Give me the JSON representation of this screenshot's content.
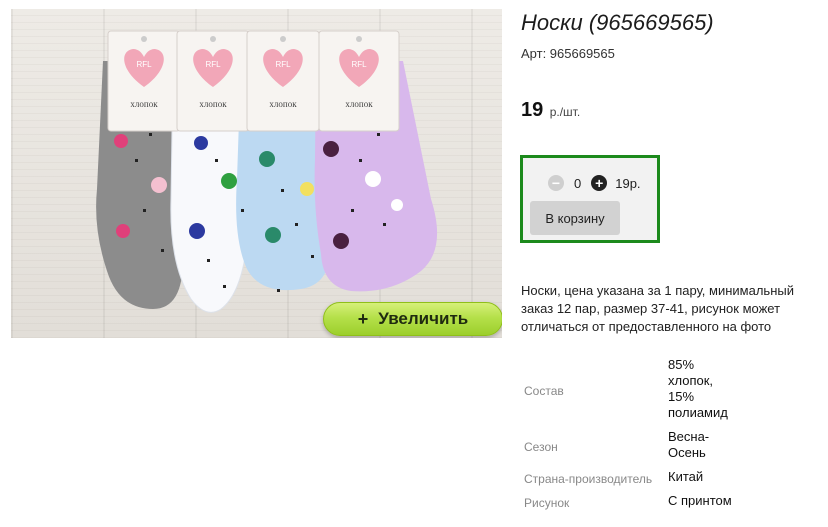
{
  "product": {
    "title": "Носки (965669565)",
    "sku": "Арт: 965669565",
    "price": "19",
    "price_unit": "р./шт.",
    "description": "Носки, цена указана за 1 пару, минимальный заказ 12 пар, размер 37-41, рисунок может отличаться от предоставленного на фото"
  },
  "image": {
    "zoom_plus": "+",
    "zoom_label": "Увеличить",
    "sock_colors": [
      "#8c8c8c",
      "#f8f9fc",
      "#bcd9f2",
      "#d8b8ec"
    ],
    "tag_size": "37-41",
    "tag_brand": "RFL",
    "tag_text": "хлопок"
  },
  "cart": {
    "minus_symbol": "−",
    "plus_symbol": "+",
    "quantity": "0",
    "sum": "19р.",
    "add_button": "В корзину",
    "border_color": "#1c8a1c"
  },
  "specs": [
    {
      "label": "Состав",
      "value": "85% хлопок, 15% полиамид"
    },
    {
      "label": "Сезон",
      "value": "Весна-Осень"
    },
    {
      "label": "Страна-производитель",
      "value": "Китай"
    },
    {
      "label": "Рисунок",
      "value": "С принтом"
    }
  ]
}
